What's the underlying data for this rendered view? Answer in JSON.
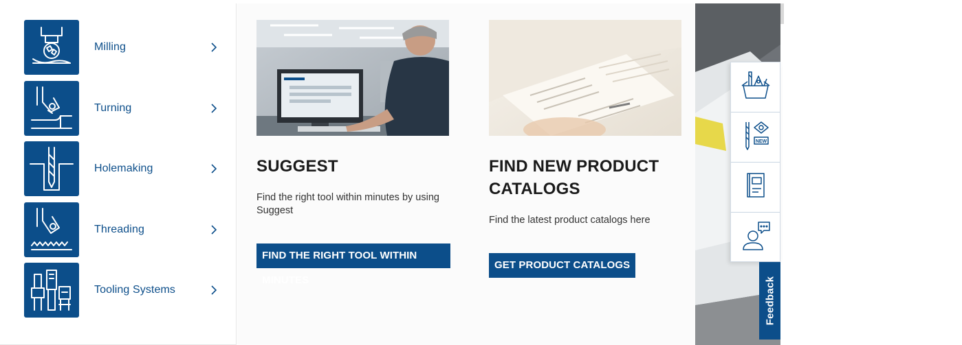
{
  "categories": [
    {
      "label": "Milling",
      "icon": "milling-icon"
    },
    {
      "label": "Turning",
      "icon": "turning-icon"
    },
    {
      "label": "Holemaking",
      "icon": "holemaking-icon"
    },
    {
      "label": "Threading",
      "icon": "threading-icon"
    },
    {
      "label": "Tooling Systems",
      "icon": "tooling-systems-icon"
    }
  ],
  "cards": [
    {
      "title": "SUGGEST",
      "description": "Find the right tool within minutes by using Suggest",
      "button": "FIND THE RIGHT TOOL WITHIN MINUTES",
      "image": "engineer-at-computer-photo"
    },
    {
      "title": "FIND NEW PRODUCT CATALOGS",
      "description": "Find the latest product catalogs here",
      "button": "GET PRODUCT CATALOGS",
      "image": "open-catalog-photo"
    }
  ],
  "quickbar": [
    {
      "icon": "product-box-icon"
    },
    {
      "icon": "new-products-icon",
      "badge": "NEW"
    },
    {
      "icon": "catalog-book-icon"
    },
    {
      "icon": "contact-chat-icon"
    }
  ],
  "feedback": {
    "label": "Feedback"
  },
  "colors": {
    "brand": "#0c4e8a",
    "text": "#1a1a1a",
    "background": "#fbfbfb"
  }
}
